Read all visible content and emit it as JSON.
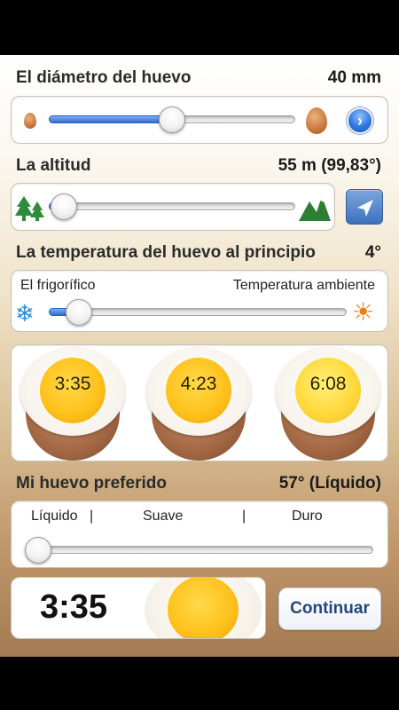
{
  "egg_diameter": {
    "label": "El diámetro del huevo",
    "value": "40 mm",
    "slider_fraction": 0.5,
    "next_icon": "chevron-right-icon"
  },
  "altitude": {
    "label": "La altitud",
    "value": "55 m (99,83°)",
    "slider_fraction": 0.02,
    "location_icon": "location-arrow-icon"
  },
  "start_temp": {
    "label": "La temperatura del huevo al principio",
    "value": "4°",
    "min_label": "El frigorífico",
    "max_label": "Temperatura ambiente",
    "slider_fraction": 0.07
  },
  "examples": [
    {
      "time": "3:35"
    },
    {
      "time": "4:23"
    },
    {
      "time": "6:08"
    }
  ],
  "preference": {
    "label": "Mi huevo preferido",
    "value": "57° (Líquido)",
    "options": {
      "liquid": "Líquido",
      "soft": "Suave",
      "hard": "Duro"
    },
    "separator_1": "|",
    "separator_2": "|",
    "slider_fraction": 0.0
  },
  "result": {
    "time": "3:35",
    "continue_label": "Continuar"
  },
  "colors": {
    "accent_blue": "#2f6fd3",
    "yolk": "#ffc21d",
    "shell": "#a66a45"
  }
}
